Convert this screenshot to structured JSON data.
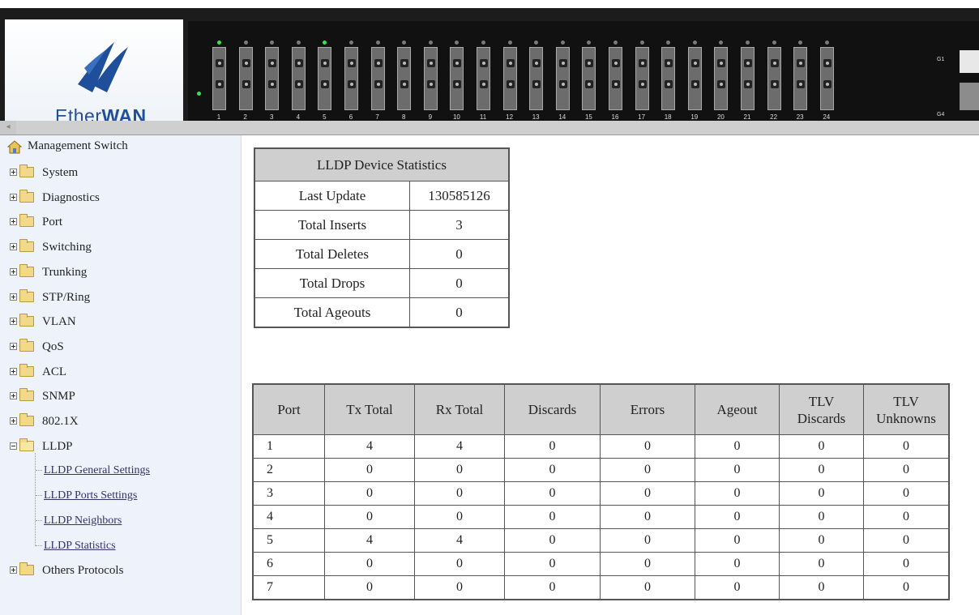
{
  "header": {
    "brand_part1": "Ether",
    "brand_part2": "WAN",
    "port_numbers": [
      "1",
      "2",
      "3",
      "4",
      "5",
      "6",
      "7",
      "8",
      "9",
      "10",
      "11",
      "12",
      "13",
      "14",
      "15",
      "16",
      "17",
      "18",
      "19",
      "20",
      "21",
      "22",
      "23",
      "24"
    ],
    "active_ports": [
      1,
      5
    ],
    "gig_label_top": "G1",
    "gig_label_bottom": "G4",
    "colors": {
      "header_bg": "#1c1c1c",
      "brand_blue": "#1f4f9a",
      "led_on": "#3fe04f"
    }
  },
  "sidebar": {
    "root": "Management Switch",
    "items": [
      {
        "label": "System",
        "icon": "folder-icon"
      },
      {
        "label": "Diagnostics",
        "icon": "folder-icon"
      },
      {
        "label": "Port",
        "icon": "folder-icon"
      },
      {
        "label": "Switching",
        "icon": "folder-icon"
      },
      {
        "label": "Trunking",
        "icon": "folder-icon"
      },
      {
        "label": "STP/Ring",
        "icon": "folder-icon"
      },
      {
        "label": "VLAN",
        "icon": "folder-icon"
      },
      {
        "label": "QoS",
        "icon": "folder-icon"
      },
      {
        "label": "ACL",
        "icon": "folder-icon"
      },
      {
        "label": "SNMP",
        "icon": "folder-icon"
      },
      {
        "label": "802.1X",
        "icon": "folder-icon"
      },
      {
        "label": "LLDP",
        "icon": "open-folder-icon"
      }
    ],
    "lldp_children": [
      "LLDP General Settings",
      "LLDP Ports Settings",
      "LLDP Neighbors",
      "LLDP Statistics"
    ],
    "last_item": "Others Protocols"
  },
  "summary": {
    "title": "LLDP Device Statistics",
    "rows": [
      {
        "label": "Last Update",
        "value": "130585126"
      },
      {
        "label": "Total Inserts",
        "value": "3"
      },
      {
        "label": "Total Deletes",
        "value": "0"
      },
      {
        "label": "Total Drops",
        "value": "0"
      },
      {
        "label": "Total Ageouts",
        "value": "0"
      }
    ]
  },
  "ports_table": {
    "headers": [
      "Port",
      "Tx Total",
      "Rx Total",
      "Discards",
      "Errors",
      "Ageout",
      "TLV Discards",
      "TLV Unknowns"
    ],
    "rows": [
      [
        "1",
        "4",
        "4",
        "0",
        "0",
        "0",
        "0",
        "0"
      ],
      [
        "2",
        "0",
        "0",
        "0",
        "0",
        "0",
        "0",
        "0"
      ],
      [
        "3",
        "0",
        "0",
        "0",
        "0",
        "0",
        "0",
        "0"
      ],
      [
        "4",
        "0",
        "0",
        "0",
        "0",
        "0",
        "0",
        "0"
      ],
      [
        "5",
        "4",
        "4",
        "0",
        "0",
        "0",
        "0",
        "0"
      ],
      [
        "6",
        "0",
        "0",
        "0",
        "0",
        "0",
        "0",
        "0"
      ],
      [
        "7",
        "0",
        "0",
        "0",
        "0",
        "0",
        "0",
        "0"
      ]
    ]
  }
}
